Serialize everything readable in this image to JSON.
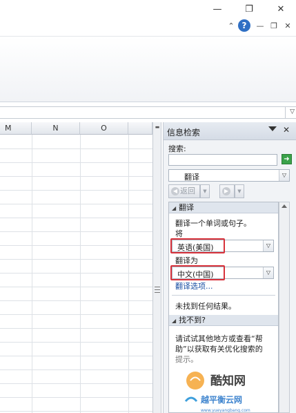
{
  "grid": {
    "columns": [
      "M",
      "N",
      "O"
    ]
  },
  "research_pane": {
    "title": "信息检索",
    "search_label": "搜索:",
    "search_value": "",
    "source": "翻译",
    "back_label": "返回",
    "section_translate": "翻译",
    "instruction": "翻译一个单词或句子。",
    "from_label": "将",
    "from_lang": "英语(美国)",
    "to_label": "翻译为",
    "to_lang": "中文(中国)",
    "options_link": "翻译选项...",
    "no_results": "未找到任何结果。",
    "section_not_found": "找不到?",
    "help_line1": "请试试其他地方或查看“帮",
    "help_line2": "助”以获取有关优化搜索的",
    "help_line3": "提示。"
  },
  "watermark": {
    "brand": "酷知网",
    "brand2": "越平衡云网",
    "url": "www.yueyangbang.com"
  },
  "colors": {
    "highlight": "#d8313a",
    "link": "#1a4fa3",
    "go": "#3aa24a"
  }
}
